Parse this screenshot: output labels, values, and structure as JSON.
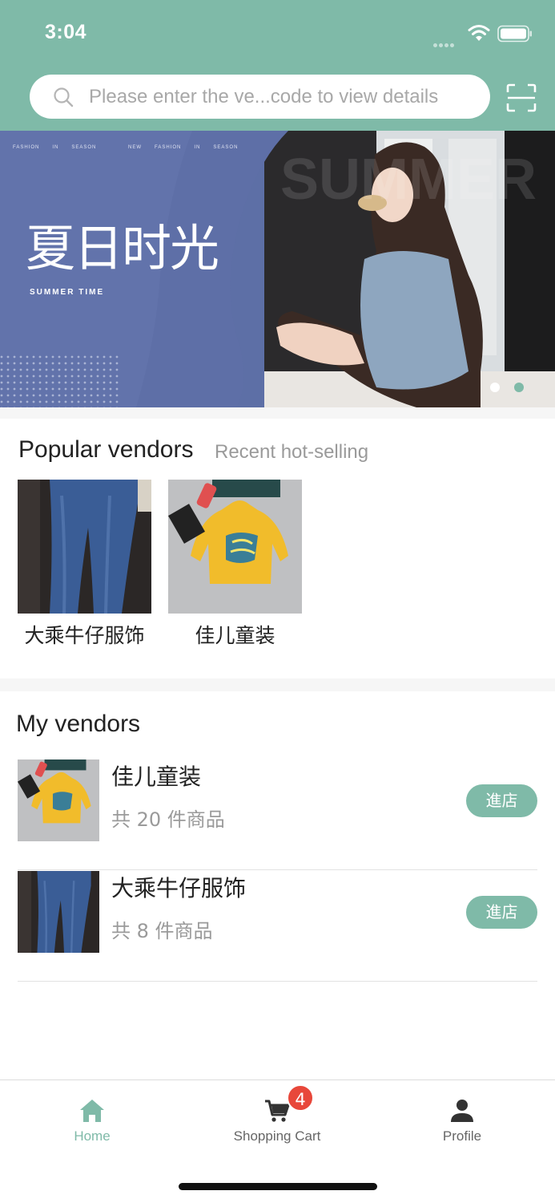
{
  "status_bar": {
    "time": "3:04"
  },
  "search": {
    "placeholder": "Please enter the ve...code to view details"
  },
  "banner": {
    "title_cn": "夏日时光",
    "title_en": "SUMMER TIME",
    "bg_text": "SUMMER",
    "small_text": [
      "FASHION",
      "IN",
      "SEASON",
      "NEW",
      "FASHION",
      "IN",
      "SEASON"
    ],
    "slides": 2,
    "active_slide": 2
  },
  "popular": {
    "title": "Popular vendors",
    "subtitle": "Recent hot-selling",
    "vendors": [
      {
        "name": "大乘牛仔服饰",
        "image_icon": "jeans-image"
      },
      {
        "name": "佳儿童装",
        "image_icon": "kids-hoodie-image"
      }
    ]
  },
  "my_vendors": {
    "title": "My vendors",
    "items": [
      {
        "name": "佳儿童装",
        "count": "共 20 件商品",
        "button": "進店",
        "image_icon": "kids-hoodie-image"
      },
      {
        "name": "大乘牛仔服饰",
        "count": "共 8 件商品",
        "button": "進店",
        "image_icon": "jeans-image"
      }
    ]
  },
  "tabbar": {
    "tabs": [
      {
        "label": "Home",
        "icon": "home-icon"
      },
      {
        "label": "Shopping Cart",
        "icon": "cart-icon",
        "badge": "4"
      },
      {
        "label": "Profile",
        "icon": "person-icon"
      }
    ]
  },
  "colors": {
    "accent": "#7fbaa8",
    "tab_inactive": "#666666",
    "badge": "#e8473a"
  }
}
